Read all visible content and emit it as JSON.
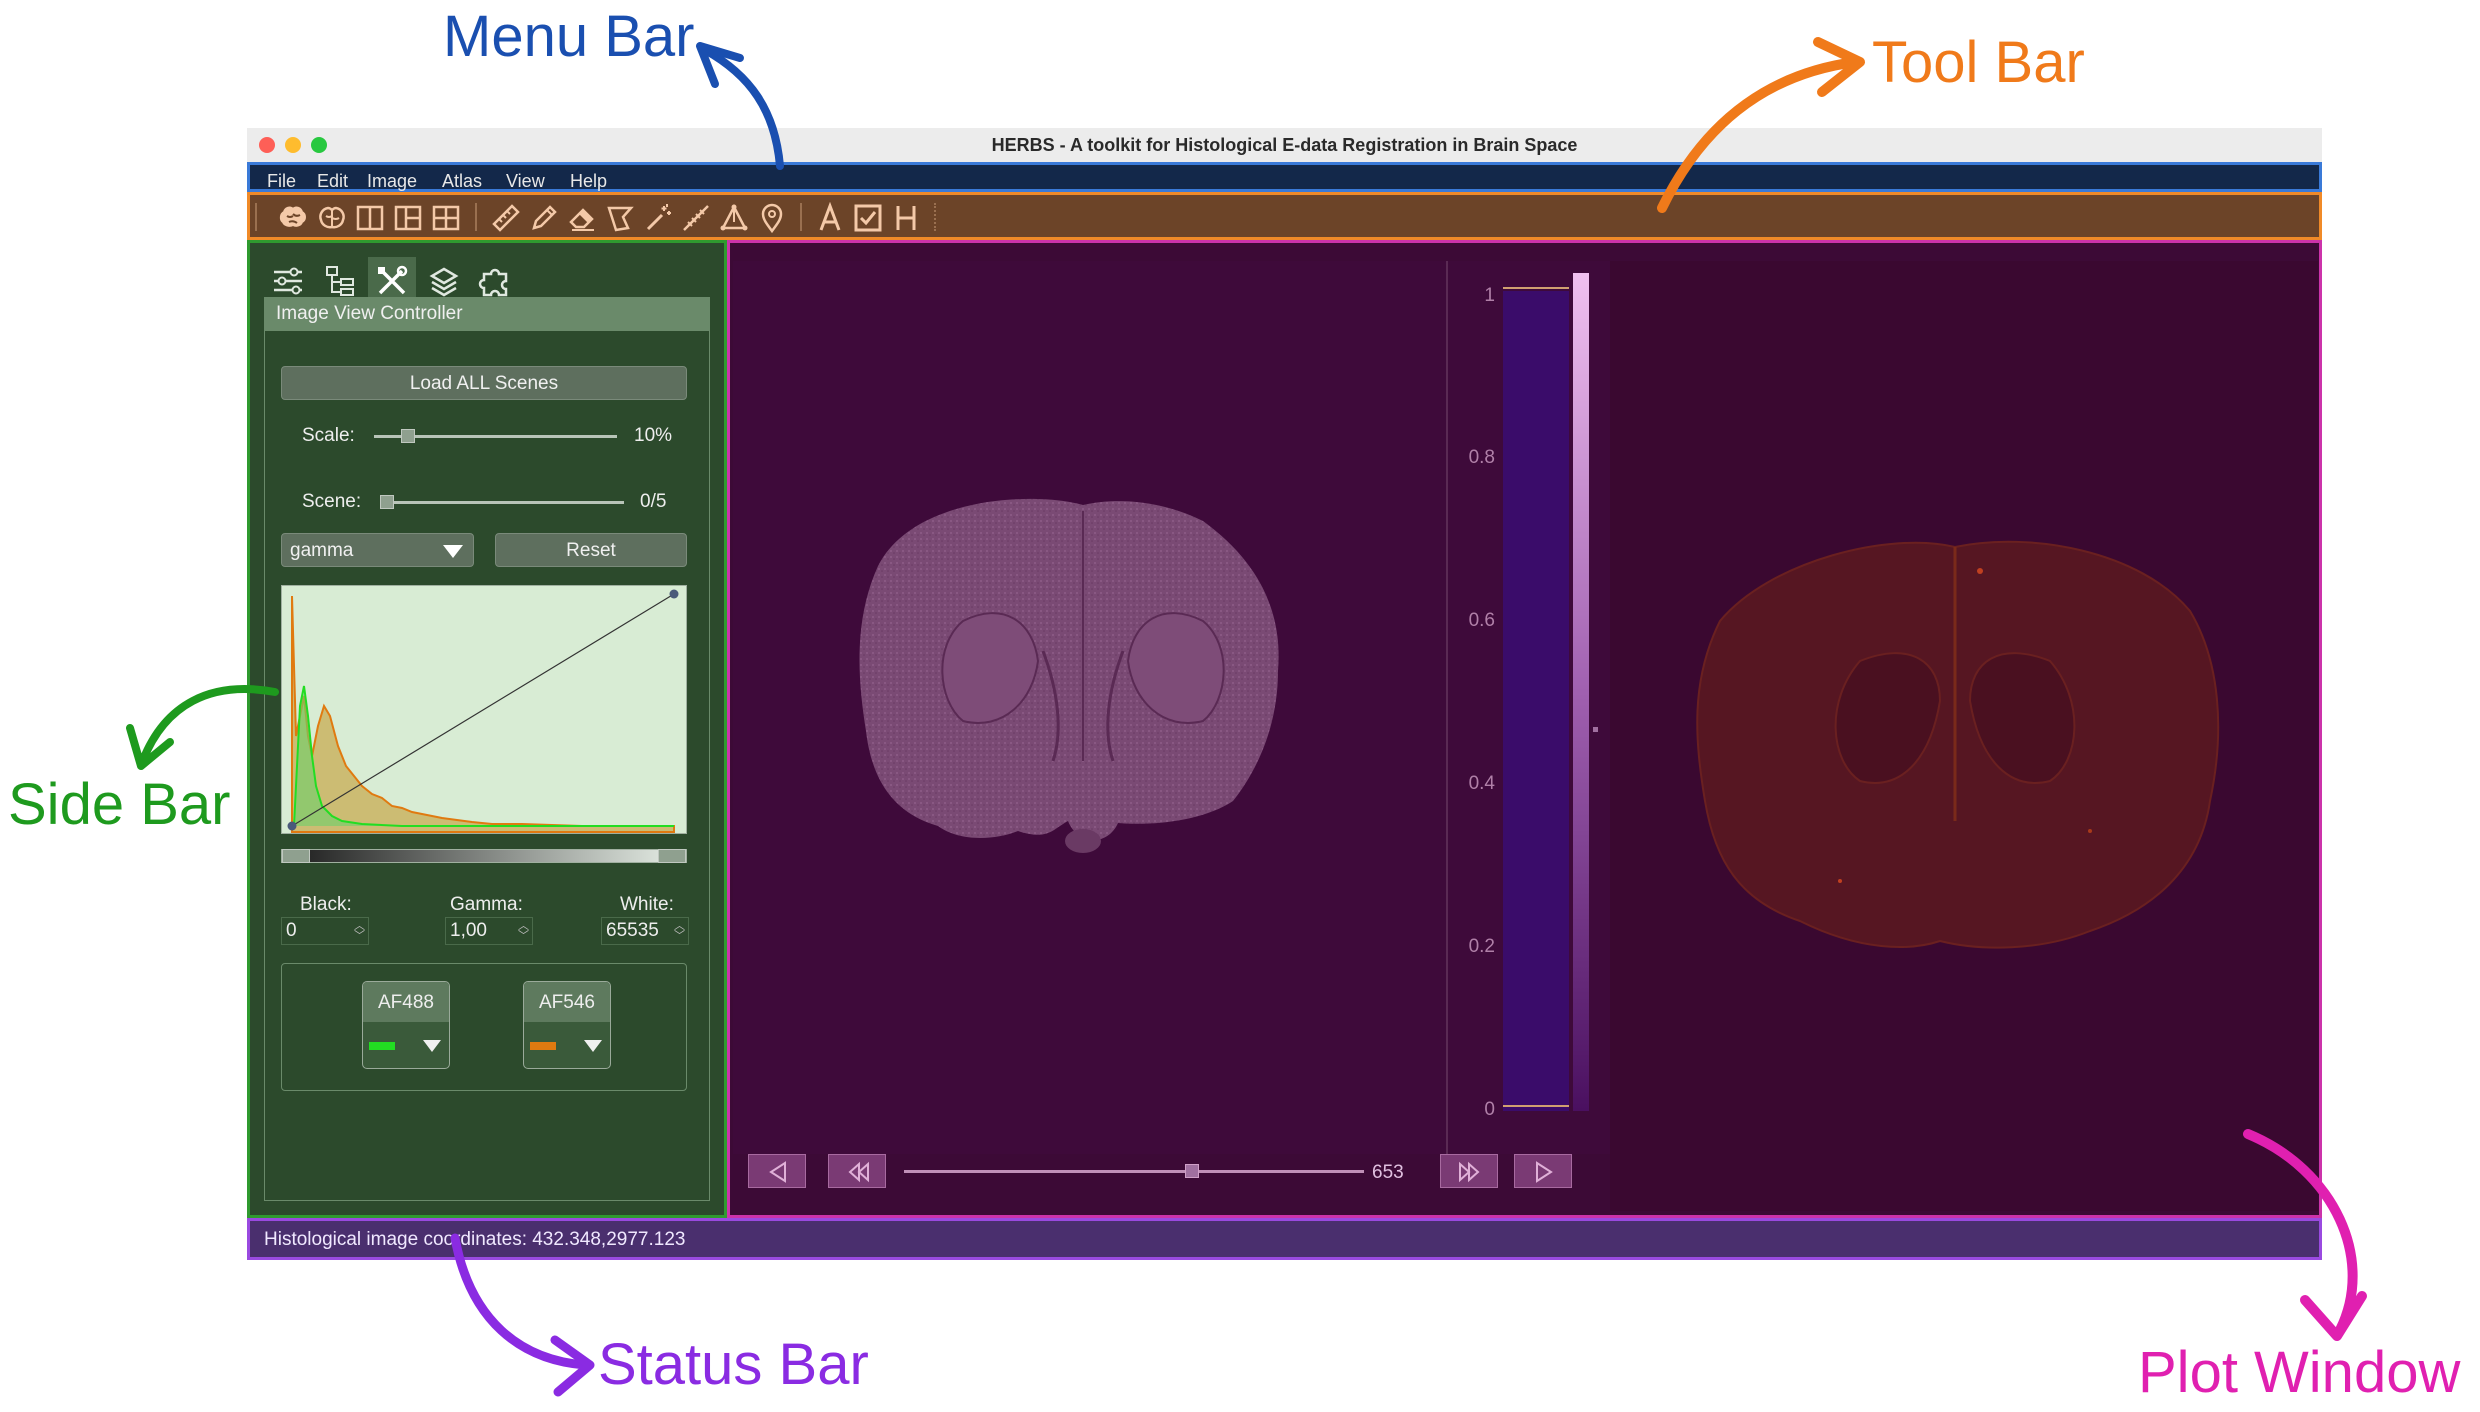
{
  "annotations": {
    "menu_bar": "Menu Bar",
    "tool_bar": "Tool Bar",
    "side_bar": "Side Bar",
    "status_bar": "Status Bar",
    "plot_window": "Plot Window"
  },
  "colors": {
    "menu_bar_ann": "#1a4fb0",
    "tool_bar_ann": "#f07a1a",
    "side_bar_ann": "#1e9a1e",
    "status_bar_ann": "#8a2be2",
    "plot_window_ann": "#e020b0"
  },
  "window": {
    "title": "HERBS - A toolkit for Histological E-data Registration in Brain Space"
  },
  "menubar": {
    "items": [
      "File",
      "Edit",
      "Image",
      "Atlas",
      "View",
      "Help"
    ]
  },
  "toolbar": {
    "icons": [
      "brain-icon",
      "brain-outline-icon",
      "layout-two-icon",
      "layout-three-icon",
      "layout-four-icon",
      "ruler-icon",
      "pencil-icon",
      "eraser-icon",
      "lasso-icon",
      "magic-wand-icon",
      "probe-icon",
      "triangle-nodes-icon",
      "location-pin-icon",
      "text-icon",
      "checkbox-icon",
      "h-icon"
    ]
  },
  "sidebar": {
    "tabs": [
      "sliders-icon",
      "tree-icon",
      "tools-icon",
      "layers-icon",
      "puzzle-icon"
    ],
    "header": "Image View Controller",
    "load_all": "Load ALL Scenes",
    "scale_label": "Scale:",
    "scale_value": "10%",
    "scale_fraction": 0.12,
    "scene_label": "Scene:",
    "scene_value": "0/5",
    "scene_fraction": 0.0,
    "mode_select": "gamma",
    "reset": "Reset",
    "black_label": "Black:",
    "black_value": "0",
    "gamma_label": "Gamma:",
    "gamma_value": "1,00",
    "white_label": "White:",
    "white_value": "65535",
    "channels": [
      {
        "name": "AF488",
        "color": "#22dd22"
      },
      {
        "name": "AF546",
        "color": "#e07a10"
      }
    ]
  },
  "plot": {
    "colorbar_ticks": [
      "1",
      "0.8",
      "0.6",
      "0.4",
      "0.2",
      "0"
    ],
    "frame_value": "653",
    "frame_fraction": 0.63
  },
  "statusbar": {
    "text": "Histological image coordinates: 432.348,2977.123"
  }
}
